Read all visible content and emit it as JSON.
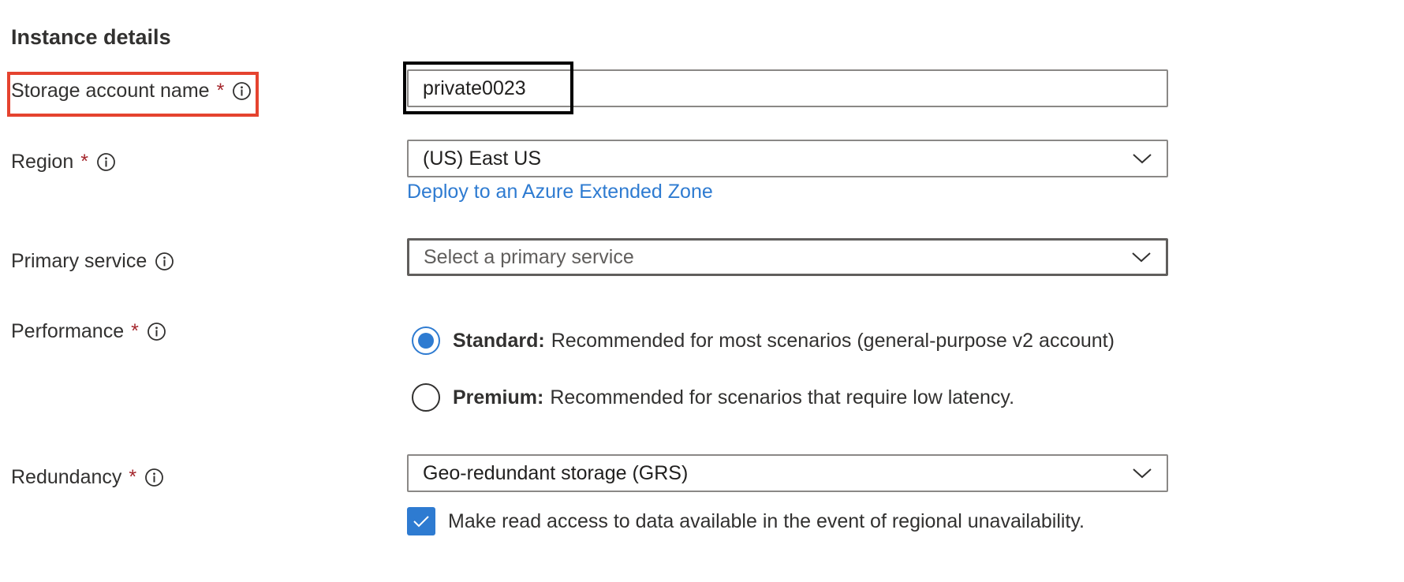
{
  "section": {
    "title": "Instance details"
  },
  "fields": {
    "storage_account_name": {
      "label": "Storage account name",
      "required_marker": "*",
      "info_icon": "info-icon",
      "value": "private0023"
    },
    "region": {
      "label": "Region",
      "required_marker": "*",
      "info_icon": "info-icon",
      "value": "(US) East US",
      "link": "Deploy to an Azure Extended Zone"
    },
    "primary_service": {
      "label": "Primary service",
      "info_icon": "info-icon",
      "placeholder": "Select a primary service"
    },
    "performance": {
      "label": "Performance",
      "required_marker": "*",
      "info_icon": "info-icon",
      "options": [
        {
          "title": "Standard:",
          "description": "Recommended for most scenarios (general-purpose v2 account)",
          "selected": true
        },
        {
          "title": "Premium:",
          "description": "Recommended for scenarios that require low latency.",
          "selected": false
        }
      ]
    },
    "redundancy": {
      "label": "Redundancy",
      "required_marker": "*",
      "info_icon": "info-icon",
      "value": "Geo-redundant storage (GRS)",
      "read_access_checkbox": {
        "label": "Make read access to data available in the event of regional unavailability.",
        "checked": true
      }
    }
  },
  "colors": {
    "accent": "#2e7bd1",
    "required": "#a4262c",
    "highlight": "#e5432f",
    "focus": "#000000"
  }
}
